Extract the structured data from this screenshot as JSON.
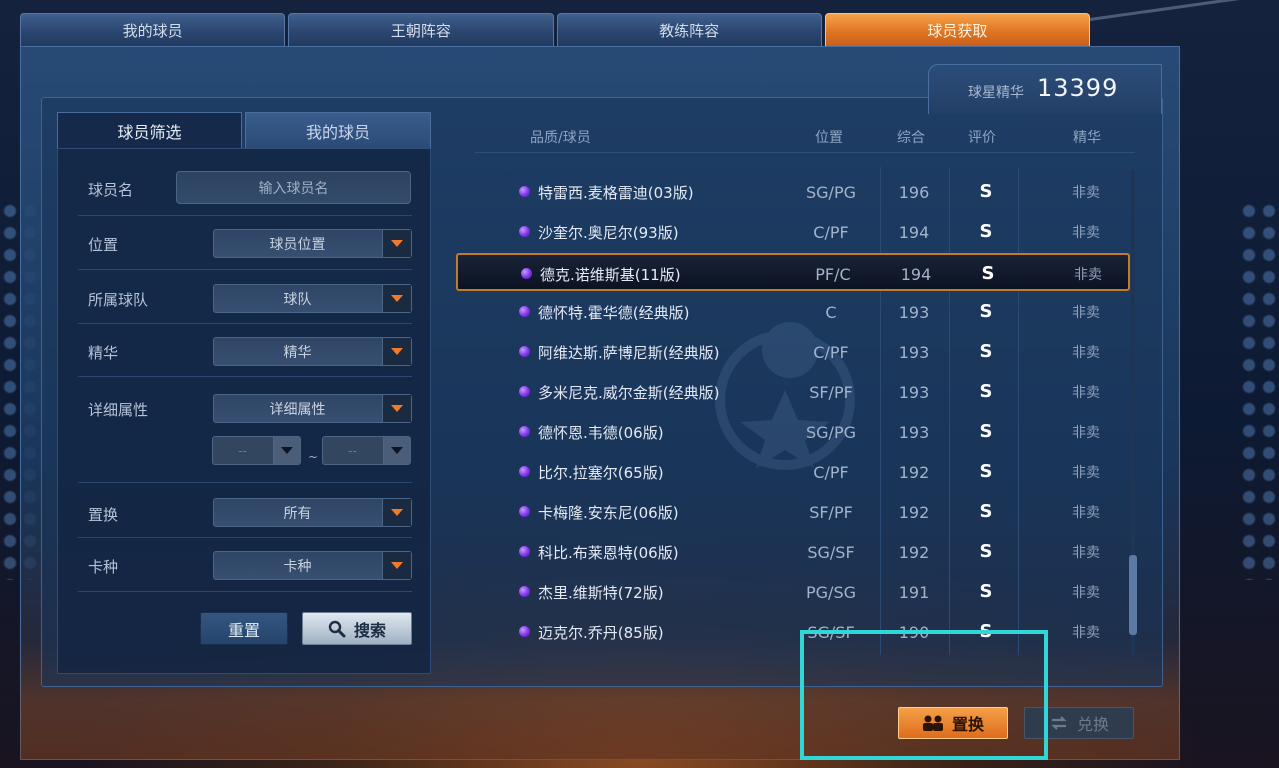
{
  "top_tabs": [
    {
      "label": "我的球员"
    },
    {
      "label": "王朝阵容"
    },
    {
      "label": "教练阵容"
    },
    {
      "label": "球员获取"
    }
  ],
  "essence": {
    "label": "球星精华",
    "value": "13399"
  },
  "filter_tabs": {
    "active": "球员筛选",
    "inactive": "我的球员"
  },
  "filters": {
    "name_label": "球员名",
    "name_placeholder": "输入球员名",
    "position_label": "位置",
    "position_value": "球员位置",
    "team_label": "所属球队",
    "team_value": "球队",
    "essence_label": "精华",
    "essence_value": "精华",
    "attr_label": "详细属性",
    "attr_value": "详细属性",
    "range_min": "--",
    "range_sep": "~",
    "range_max": "--",
    "replace_label": "置换",
    "replace_value": "所有",
    "card_label": "卡种",
    "card_value": "卡种",
    "reset_button": "重置",
    "search_button": "搜索"
  },
  "table": {
    "headers": {
      "name": "品质/球员",
      "position": "位置",
      "overall": "综合",
      "rating": "评价",
      "essence": "精华"
    },
    "rows": [
      {
        "name": "特雷西.麦格雷迪(03版)",
        "position": "SG/PG",
        "overall": "196",
        "rating": "S",
        "essence": "非卖"
      },
      {
        "name": "沙奎尔.奥尼尔(93版)",
        "position": "C/PF",
        "overall": "194",
        "rating": "S",
        "essence": "非卖"
      },
      {
        "name": "德克.诺维斯基(11版)",
        "position": "PF/C",
        "overall": "194",
        "rating": "S",
        "essence": "非卖",
        "selected": true
      },
      {
        "name": "德怀特.霍华德(经典版)",
        "position": "C",
        "overall": "193",
        "rating": "S",
        "essence": "非卖"
      },
      {
        "name": "阿维达斯.萨博尼斯(经典版)",
        "position": "C/PF",
        "overall": "193",
        "rating": "S",
        "essence": "非卖"
      },
      {
        "name": "多米尼克.威尔金斯(经典版)",
        "position": "SF/PF",
        "overall": "193",
        "rating": "S",
        "essence": "非卖"
      },
      {
        "name": "德怀恩.韦德(06版)",
        "position": "SG/PG",
        "overall": "193",
        "rating": "S",
        "essence": "非卖"
      },
      {
        "name": "比尔.拉塞尔(65版)",
        "position": "C/PF",
        "overall": "192",
        "rating": "S",
        "essence": "非卖"
      },
      {
        "name": "卡梅隆.安东尼(06版)",
        "position": "SF/PF",
        "overall": "192",
        "rating": "S",
        "essence": "非卖"
      },
      {
        "name": "科比.布莱恩特(06版)",
        "position": "SG/SF",
        "overall": "192",
        "rating": "S",
        "essence": "非卖"
      },
      {
        "name": "杰里.维斯特(72版)",
        "position": "PG/SG",
        "overall": "191",
        "rating": "S",
        "essence": "非卖"
      },
      {
        "name": "迈克尔.乔丹(85版)",
        "position": "SG/SF",
        "overall": "190",
        "rating": "S",
        "essence": "非卖"
      }
    ]
  },
  "actions": {
    "replace_button": "置换",
    "exchange_button": "兑换"
  },
  "colors": {
    "accent": "#e07522",
    "highlight": "#33d6d6",
    "quality_dot": "#7d34e8"
  }
}
